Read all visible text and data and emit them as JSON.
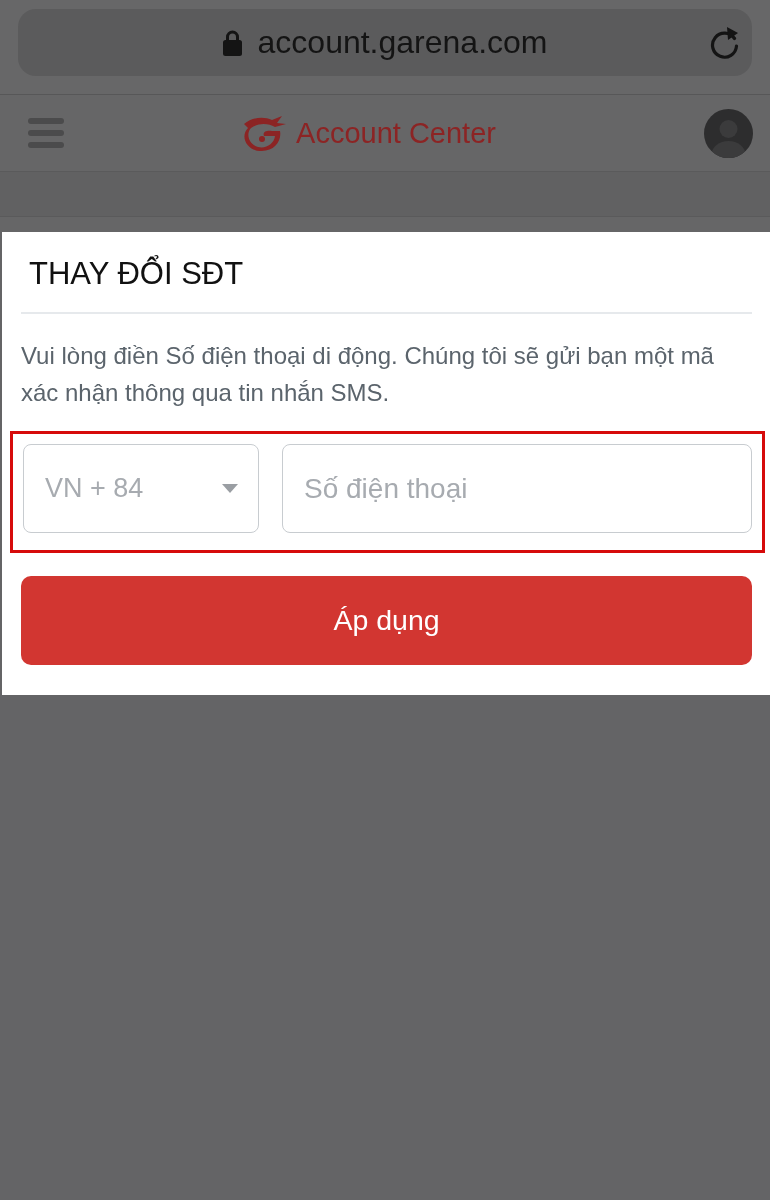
{
  "browser": {
    "url": "account.garena.com"
  },
  "header": {
    "title": "Account Center"
  },
  "dialog": {
    "title": "THAY ĐỔI SĐT",
    "message": "Vui lòng điền Số điện thoại di động. Chúng tôi sẽ gửi bạn một mã xác nhận thông qua tin nhắn SMS.",
    "highlighted": true,
    "country_select": {
      "value": "VN + 84"
    },
    "phone_field": {
      "placeholder": "Số điện thoại"
    },
    "submit_button": "Áp dụng"
  }
}
